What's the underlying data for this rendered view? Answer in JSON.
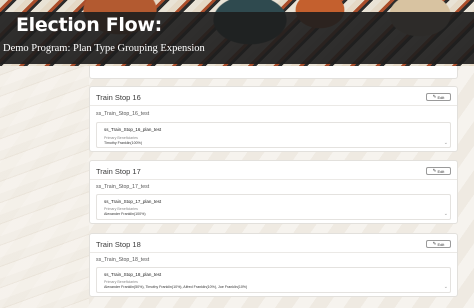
{
  "header": {
    "title": "Election Flow:",
    "subtitle": "Demo Program: Plan Type Grouping Expension"
  },
  "cards": [
    {
      "title": "Train Stop 16",
      "edit_label": "Edit",
      "plan_label": "ss_Train_Stop_16_test",
      "plan_name": "ss_Train_Stop_16_plan_test",
      "beneficiary_label": "Primary Beneficiaries",
      "beneficiaries": "Timothy Franklin(100%)"
    },
    {
      "title": "Train Stop 17",
      "edit_label": "Edit",
      "plan_label": "ss_Train_Stop_17_test",
      "plan_name": "ss_Train_Stop_17_plan_test",
      "beneficiary_label": "Primary Beneficiaries",
      "beneficiaries": "Alexander Franklin(100%)"
    },
    {
      "title": "Train Stop 18",
      "edit_label": "Edit",
      "plan_label": "ss_Train_Stop_18_test",
      "plan_name": "ss_Train_Stop_18_plan_test",
      "beneficiary_label": "Primary Beneficiaries",
      "beneficiaries": "Alexander Franklin(50%), Timothy Franklin(10%), Alfred Franklin(10%), Joe Franklin(10%)"
    }
  ],
  "icons": {
    "edit": "pencil-icon",
    "expand": "chevron-down-icon"
  },
  "colors": {
    "header_bg": "#1e1e1e",
    "card_bg": "#ffffff",
    "page_bg": "#f4f3f1"
  }
}
